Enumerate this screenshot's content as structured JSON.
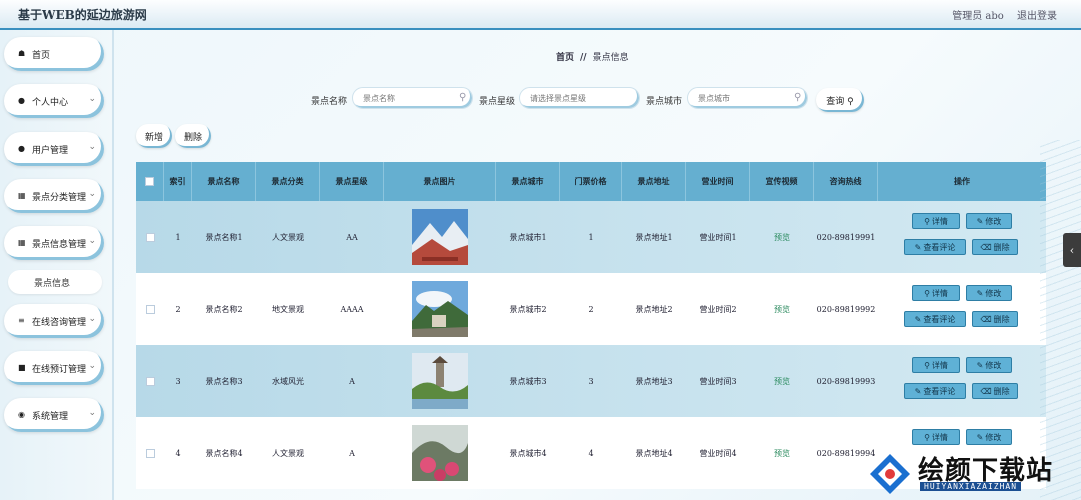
{
  "header": {
    "site_title": "基于WEB的延边旅游网",
    "admin_label": "管理员 abo",
    "logout_label": "退出登录"
  },
  "sidebar": {
    "items": [
      {
        "label": "首页",
        "icon": "home-icon",
        "chevron": false
      },
      {
        "label": "个人中心",
        "icon": "user-icon",
        "chevron": true
      },
      {
        "label": "用户管理",
        "icon": "user-icon",
        "chevron": true
      },
      {
        "label": "景点分类管理",
        "icon": "grid-icon",
        "chevron": true
      },
      {
        "label": "景点信息管理",
        "icon": "grid-icon",
        "chevron": true
      },
      {
        "label": "在线咨询管理",
        "icon": "sliders-icon",
        "chevron": true
      },
      {
        "label": "在线预订管理",
        "icon": "message-icon",
        "chevron": true
      },
      {
        "label": "系统管理",
        "icon": "bulb-icon",
        "chevron": true
      }
    ],
    "subitem": "景点信息"
  },
  "breadcrumb": {
    "home": "首页",
    "sep": "//",
    "current": "景点信息"
  },
  "search": {
    "name_label": "景点名称",
    "name_placeholder": "景点名称",
    "star_label": "景点星级",
    "star_placeholder": "请选择景点星级",
    "city_label": "景点城市",
    "city_placeholder": "景点城市",
    "query_label": "查询"
  },
  "toolbar": {
    "add_label": "新增",
    "delete_label": "删除"
  },
  "table": {
    "headers": [
      "",
      "索引",
      "景点名称",
      "景点分类",
      "景点星级",
      "景点图片",
      "景点城市",
      "门票价格",
      "景点地址",
      "营业时间",
      "宣传视频",
      "咨询热线",
      "操作"
    ],
    "rows": [
      {
        "index": "1",
        "name": "景点名称1",
        "category": "人文景观",
        "star": "AA",
        "city": "景点城市1",
        "price": "1",
        "address": "景点地址1",
        "hours": "营业时间1",
        "video": "预览",
        "phone": "020-89819991"
      },
      {
        "index": "2",
        "name": "景点名称2",
        "category": "地文景观",
        "star": "AAAA",
        "city": "景点城市2",
        "price": "2",
        "address": "景点地址2",
        "hours": "营业时间2",
        "video": "预览",
        "phone": "020-89819992"
      },
      {
        "index": "3",
        "name": "景点名称3",
        "category": "水域风光",
        "star": "A",
        "city": "景点城市3",
        "price": "3",
        "address": "景点地址3",
        "hours": "营业时间3",
        "video": "预览",
        "phone": "020-89819993"
      },
      {
        "index": "4",
        "name": "景点名称4",
        "category": "人文景观",
        "star": "A",
        "city": "景点城市4",
        "price": "4",
        "address": "景点地址4",
        "hours": "营业时间4",
        "video": "预览",
        "phone": "020-89819994"
      }
    ],
    "actions": {
      "detail": "详情",
      "edit": "修改",
      "comments": "查看评论",
      "delete": "删除"
    }
  },
  "watermark": {
    "text": "绘颜下载站",
    "sub": "HUIYANXIAZAIZHAN"
  },
  "colors": {
    "header_bg": "#65afd0",
    "alt_row": "#c4e1ee",
    "action_btn": "#5fb1d6",
    "accent": "#3a8fbf"
  }
}
